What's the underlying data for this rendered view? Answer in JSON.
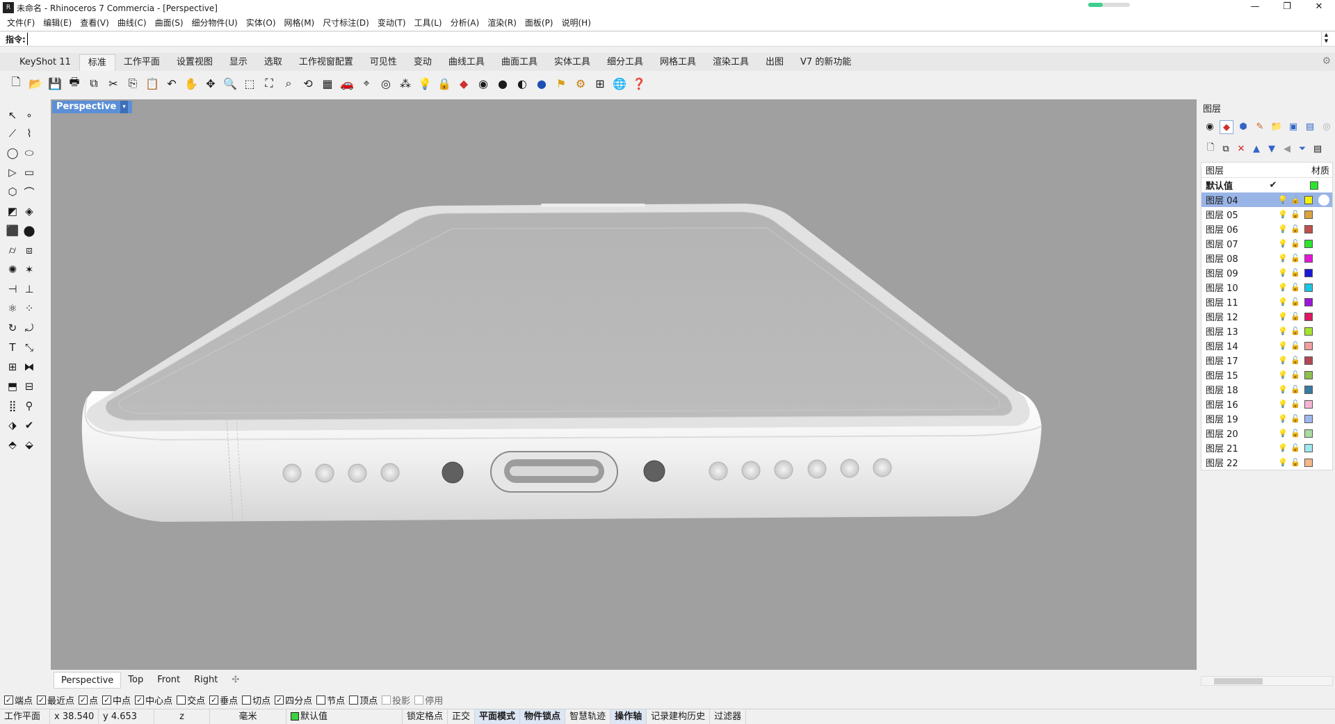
{
  "window": {
    "title": "未命名 - Rhinoceros 7 Commercia - [Perspective]",
    "controls": {
      "minimize": "—",
      "maximize": "❐",
      "close": "✕"
    },
    "progress": 0.35
  },
  "menu": [
    "文件(F)",
    "编辑(E)",
    "查看(V)",
    "曲线(C)",
    "曲面(S)",
    "细分物件(U)",
    "实体(O)",
    "网格(M)",
    "尺寸标注(D)",
    "变动(T)",
    "工具(L)",
    "分析(A)",
    "渲染(R)",
    "面板(P)",
    "说明(H)"
  ],
  "command": {
    "label": "指令:",
    "value": ""
  },
  "tabs": [
    "KeyShot 11",
    "标准",
    "工作平面",
    "设置视图",
    "显示",
    "选取",
    "工作视窗配置",
    "可见性",
    "变动",
    "曲线工具",
    "曲面工具",
    "实体工具",
    "细分工具",
    "网格工具",
    "渲染工具",
    "出图",
    "V7 的新功能"
  ],
  "active_tab": "标准",
  "viewport": {
    "title": "Perspective",
    "dropdown": "▾"
  },
  "viewport_tabs": [
    "Perspective",
    "Top",
    "Front",
    "Right"
  ],
  "viewport_tabs_plus": "✣",
  "layers_panel": {
    "title": "图层",
    "col_layer": "图层",
    "col_material": "材质",
    "layers": [
      {
        "name": "默认值",
        "color": "#2ee32e",
        "current": true,
        "selected": false
      },
      {
        "name": "图层 04",
        "color": "#f2f209",
        "current": false,
        "selected": true
      },
      {
        "name": "图层 05",
        "color": "#d9a43f",
        "current": false,
        "selected": false
      },
      {
        "name": "图层 06",
        "color": "#c0504d",
        "current": false,
        "selected": false
      },
      {
        "name": "图层 07",
        "color": "#2ee32e",
        "current": false,
        "selected": false
      },
      {
        "name": "图层 08",
        "color": "#e815d8",
        "current": false,
        "selected": false
      },
      {
        "name": "图层 09",
        "color": "#1a1ad6",
        "current": false,
        "selected": false
      },
      {
        "name": "图层 10",
        "color": "#19c7e3",
        "current": false,
        "selected": false
      },
      {
        "name": "图层 11",
        "color": "#9b16d6",
        "current": false,
        "selected": false
      },
      {
        "name": "图层 12",
        "color": "#e0185f",
        "current": false,
        "selected": false
      },
      {
        "name": "图层 13",
        "color": "#a6e32e",
        "current": false,
        "selected": false
      },
      {
        "name": "图层 14",
        "color": "#f0a0a0",
        "current": false,
        "selected": false
      },
      {
        "name": "图层 17",
        "color": "#b34755",
        "current": false,
        "selected": false
      },
      {
        "name": "图层 15",
        "color": "#8fbf4f",
        "current": false,
        "selected": false
      },
      {
        "name": "图层 18",
        "color": "#3a7aa0",
        "current": false,
        "selected": false
      },
      {
        "name": "图层 16",
        "color": "#f5b5d5",
        "current": false,
        "selected": false
      },
      {
        "name": "图层 19",
        "color": "#a0b8f0",
        "current": false,
        "selected": false
      },
      {
        "name": "图层 20",
        "color": "#a9dca0",
        "current": false,
        "selected": false
      },
      {
        "name": "图层 21",
        "color": "#a0e8ec",
        "current": false,
        "selected": false
      },
      {
        "name": "图层 22",
        "color": "#f5b88a",
        "current": false,
        "selected": false
      }
    ]
  },
  "osnap": [
    {
      "label": "端点",
      "checked": true
    },
    {
      "label": "最近点",
      "checked": true
    },
    {
      "label": "点",
      "checked": true
    },
    {
      "label": "中点",
      "checked": true
    },
    {
      "label": "中心点",
      "checked": true
    },
    {
      "label": "交点",
      "checked": false
    },
    {
      "label": "垂点",
      "checked": true
    },
    {
      "label": "切点",
      "checked": false
    },
    {
      "label": "四分点",
      "checked": true
    },
    {
      "label": "节点",
      "checked": false
    },
    {
      "label": "顶点",
      "checked": false
    },
    {
      "label": "投影",
      "checked": false,
      "disabled": true
    },
    {
      "label": "停用",
      "checked": false,
      "disabled": true
    }
  ],
  "status": {
    "cplane": "工作平面",
    "x": "x 38.540",
    "y": "y 4.653",
    "z": "z",
    "units": "毫米",
    "layer": "默认值",
    "grid_snap": "锁定格点",
    "ortho": "正交",
    "planar": "平面模式",
    "osnap": "物件锁点",
    "smarttrack": "智慧轨迹",
    "gumball": "操作轴",
    "history": "记录建构历史",
    "filter": "过滤器"
  }
}
